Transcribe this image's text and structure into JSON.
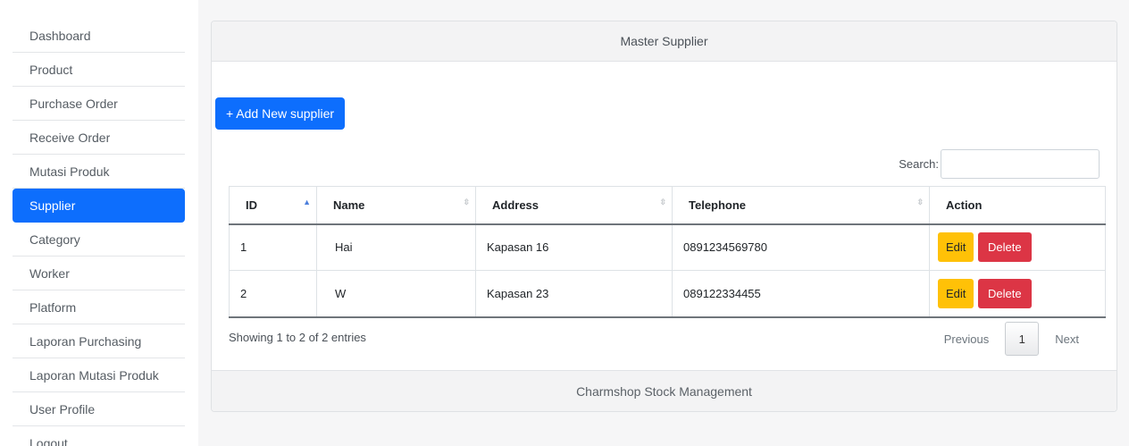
{
  "sidebar": {
    "items": [
      {
        "label": "Dashboard"
      },
      {
        "label": "Product"
      },
      {
        "label": "Purchase Order"
      },
      {
        "label": "Receive Order"
      },
      {
        "label": "Mutasi Produk"
      },
      {
        "label": "Supplier",
        "active": true
      },
      {
        "label": "Category"
      },
      {
        "label": "Worker"
      },
      {
        "label": "Platform"
      },
      {
        "label": "Laporan Purchasing"
      },
      {
        "label": "Laporan Mutasi Produk"
      },
      {
        "label": "User Profile"
      },
      {
        "label": "Logout"
      }
    ]
  },
  "card": {
    "title": "Master Supplier",
    "footer": "Charmshop Stock Management"
  },
  "toolbar": {
    "add_label": "+ Add New supplier"
  },
  "search": {
    "label": "Search:",
    "value": "",
    "placeholder": ""
  },
  "table": {
    "columns": [
      "ID",
      "Name",
      "Address",
      "Telephone",
      "Action"
    ],
    "sorted_column": "ID",
    "rows": [
      {
        "id": "1",
        "name": "Hai",
        "address": "Kapasan 16",
        "telephone": "0891234569780"
      },
      {
        "id": "2",
        "name": "W",
        "address": "Kapasan 23",
        "telephone": "089122334455"
      }
    ],
    "edit_label": "Edit",
    "delete_label": "Delete"
  },
  "pagination": {
    "info": "Showing 1 to 2 of 2 entries",
    "previous": "Previous",
    "current_page": "1",
    "next": "Next"
  },
  "colors": {
    "primary": "#0d6efd",
    "warning": "#ffc107",
    "danger": "#dc3545"
  }
}
